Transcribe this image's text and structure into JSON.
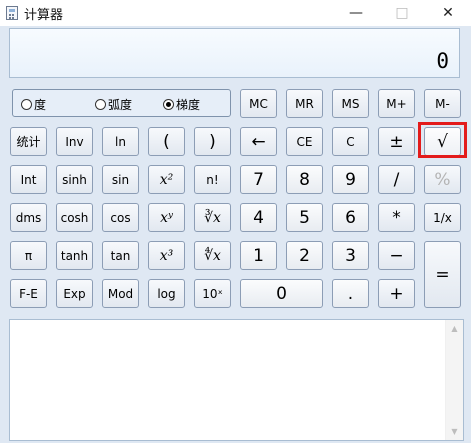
{
  "window": {
    "title": "计算器",
    "minimize": "—",
    "maximize": "□",
    "close": "✕"
  },
  "display": {
    "value": "0"
  },
  "angle_mode": {
    "options": [
      {
        "label": "度",
        "selected": false
      },
      {
        "label": "弧度",
        "selected": false
      },
      {
        "label": "梯度",
        "selected": true
      }
    ]
  },
  "memory": {
    "mc": "MC",
    "mr": "MR",
    "ms": "MS",
    "mplus": "M+",
    "mminus": "M-"
  },
  "sci": {
    "row1": [
      "统计",
      "Inv",
      "ln",
      "(",
      ")"
    ],
    "row2": [
      "Int",
      "sinh",
      "sin",
      "x²",
      "n!"
    ],
    "row3": [
      "dms",
      "cosh",
      "cos",
      "xʸ",
      "∛x"
    ],
    "row4": [
      "π",
      "tanh",
      "tan",
      "x³",
      "∜x"
    ],
    "row5": [
      "F-E",
      "Exp",
      "Mod",
      "log",
      "10ˣ"
    ]
  },
  "std": {
    "row1": [
      "←",
      "CE",
      "C",
      "±",
      "√"
    ],
    "row2": [
      "7",
      "8",
      "9",
      "/",
      "%"
    ],
    "row3": [
      "4",
      "5",
      "6",
      "*",
      "1/x"
    ],
    "row4": [
      "1",
      "2",
      "3",
      "−"
    ],
    "row5": [
      "0",
      ".",
      "+"
    ],
    "equals": "="
  },
  "highlight": {
    "button": "√",
    "color": "#e31b1b"
  },
  "history": {
    "up_arrow": "▲",
    "down_arrow": "▼"
  }
}
